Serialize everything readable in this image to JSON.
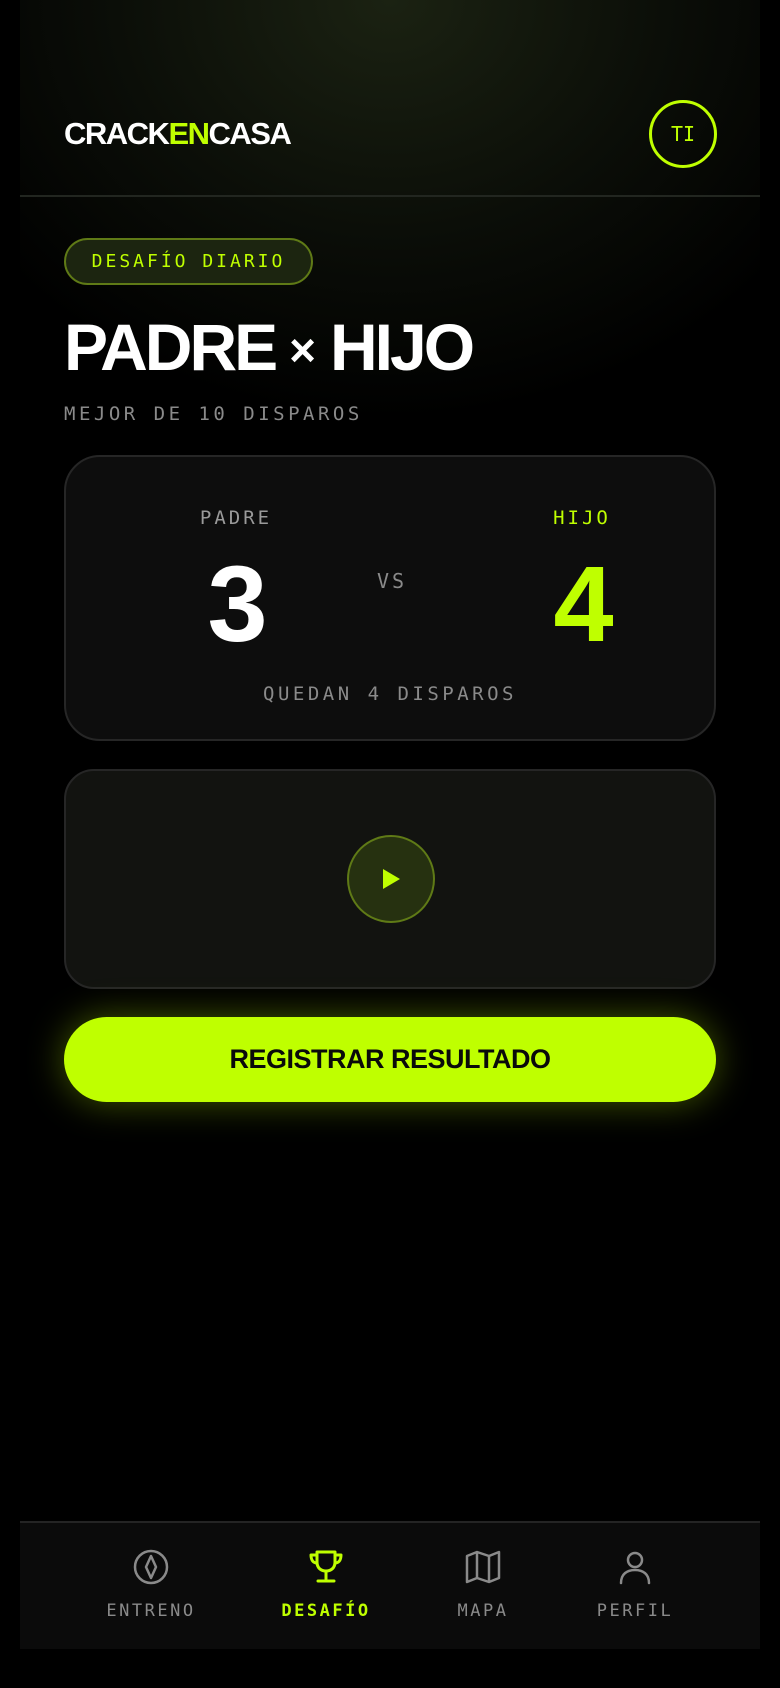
{
  "header": {
    "logo_part1": "CRACK",
    "logo_part2": "EN",
    "logo_part3": "CASA",
    "avatar_initials": "TI"
  },
  "challenge": {
    "badge": "DESAFÍO DIARIO",
    "title_left": "PADRE",
    "title_separator": "×",
    "title_right": "HIJO",
    "subtitle": "MEJOR DE 10 DISPAROS"
  },
  "score": {
    "left_label": "PADRE",
    "left_value": "3",
    "vs_label": "VS",
    "right_label": "HIJO",
    "right_value": "4",
    "remaining": "QUEDAN 4 DISPAROS"
  },
  "video": {
    "play_icon": "play-icon"
  },
  "cta": {
    "label": "REGISTRAR RESULTADO"
  },
  "nav": {
    "items": [
      {
        "label": "ENTRENO",
        "icon": "ball-icon",
        "active": false
      },
      {
        "label": "DESAFÍO",
        "icon": "trophy-icon",
        "active": true
      },
      {
        "label": "MAPA",
        "icon": "map-icon",
        "active": false
      },
      {
        "label": "PERFIL",
        "icon": "user-icon",
        "active": false
      }
    ]
  },
  "colors": {
    "accent": "#bfff00",
    "background": "#000000",
    "muted": "#8a8a8a"
  }
}
